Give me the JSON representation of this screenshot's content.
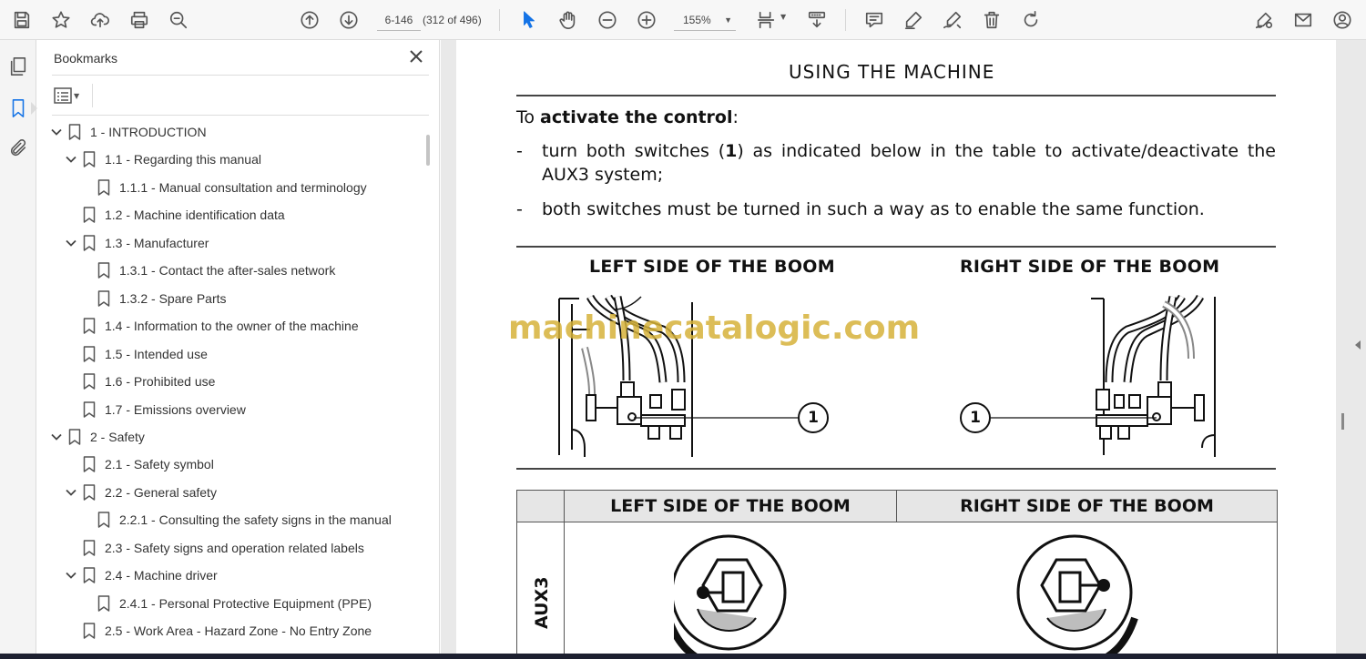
{
  "toolbar": {
    "page_number": "6-146",
    "page_count": "(312 of 496)",
    "zoom": "155%"
  },
  "bookmarks": {
    "title": "Bookmarks",
    "items": [
      {
        "label": "1  -  INTRODUCTION",
        "level": 0,
        "expanded": true
      },
      {
        "label": "1.1 - Regarding this manual",
        "level": 1,
        "expanded": true
      },
      {
        "label": "1.1.1 - Manual consultation and terminology",
        "level": 2
      },
      {
        "label": "1.2 - Machine identification data",
        "level": 1
      },
      {
        "label": "1.3 - Manufacturer",
        "level": 1,
        "expanded": true
      },
      {
        "label": "1.3.1 - Contact the after-sales network",
        "level": 2
      },
      {
        "label": "1.3.2 - Spare Parts",
        "level": 2
      },
      {
        "label": "1.4 - Information to the owner of the machine",
        "level": 1
      },
      {
        "label": "1.5 - Intended use",
        "level": 1
      },
      {
        "label": "1.6 - Prohibited use",
        "level": 1
      },
      {
        "label": "1.7 - Emissions overview",
        "level": 1
      },
      {
        "label": "2  -  Safety",
        "level": 0,
        "expanded": true
      },
      {
        "label": "2.1 - Safety symbol",
        "level": 1
      },
      {
        "label": "2.2 - General safety",
        "level": 1,
        "expanded": true
      },
      {
        "label": "2.2.1 - Consulting the safety signs in the manual",
        "level": 2
      },
      {
        "label": "2.3 - Safety signs and operation related labels",
        "level": 1
      },
      {
        "label": "2.4 - Machine driver",
        "level": 1,
        "expanded": true
      },
      {
        "label": "2.4.1 - Personal Protective Equipment (PPE)",
        "level": 2
      },
      {
        "label": "2.5 - Work Area - Hazard Zone - No Entry Zone",
        "level": 1
      }
    ]
  },
  "document": {
    "heading": "USING THE MACHINE",
    "intro_prefix": "To ",
    "intro_bold": "activate the control",
    "intro_suffix": ":",
    "bullet_dash": "-",
    "bullet1_prefix": "turn both switches (",
    "bullet1_bold": "1",
    "bullet1_suffix": ") as indicated below in the table to activate/deactivate the AUX3 system;",
    "bullet2": "both switches must be turned in such a way as to enable the same function.",
    "fig_left_label": "LEFT SIDE OF THE BOOM",
    "fig_right_label": "RIGHT SIDE OF THE BOOM",
    "callout": "1",
    "watermark": "machinecatalogic.com",
    "table": {
      "col_left": "LEFT SIDE OF THE BOOM",
      "col_right": "RIGHT SIDE OF THE BOOM",
      "row_label": "AUX3"
    }
  }
}
